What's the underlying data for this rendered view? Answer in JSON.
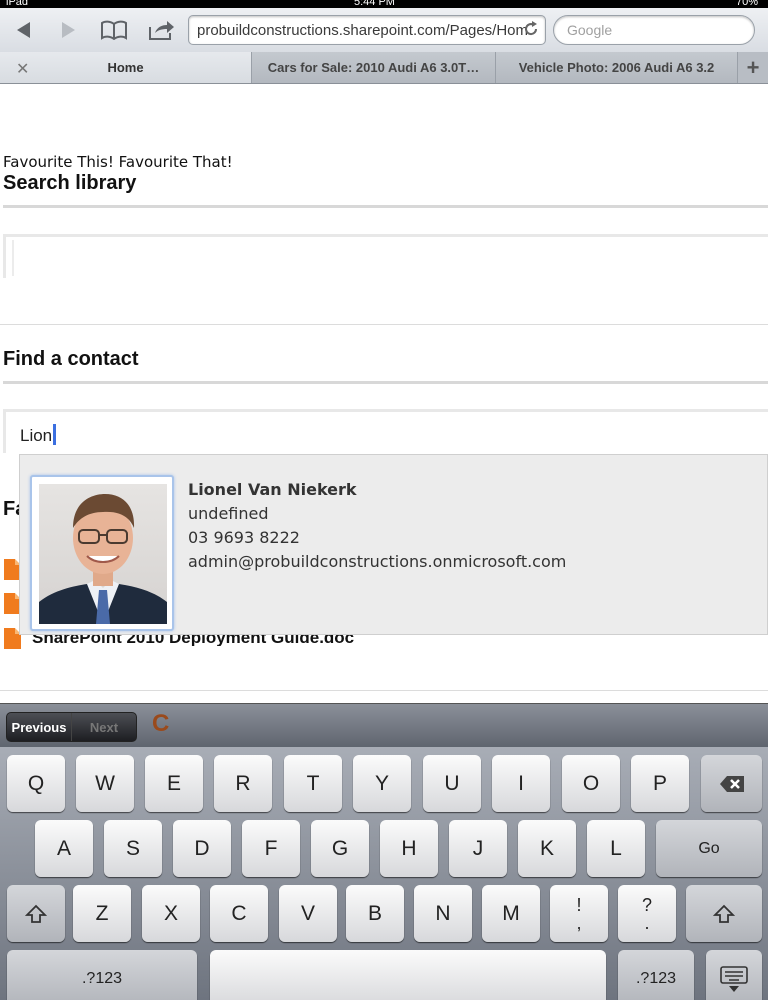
{
  "status": {
    "left": "iPad",
    "time": "5:44 PM",
    "battery": "70%"
  },
  "toolbar": {
    "url": "probuildconstructions.sharepoint.com/Pages/Hom",
    "search_placeholder": "Google"
  },
  "tabs": [
    {
      "label": "Home",
      "active": true
    },
    {
      "label": "Cars for Sale: 2010 Audi A6 3.0T…",
      "active": false
    },
    {
      "label": "Vehicle Photo: 2006 Audi A6 3.2",
      "active": false
    }
  ],
  "page": {
    "fav_line": "Favourite This! Favourite That!",
    "search_heading": "Search library",
    "contact_heading": "Find a contact",
    "contact_value": "Lion",
    "fa_partial": "Fa",
    "doc_link": "SharePoint 2010 Deployment Guide.doc"
  },
  "contact_card": {
    "name": "Lionel Van Niekerk",
    "line1": "undefined",
    "phone": "03 9693 8222",
    "email": "admin@probuildconstructions.onmicrosoft.com"
  },
  "keyboard": {
    "previous": "Previous",
    "next": "Next",
    "behind_text": "C",
    "row1": [
      "Q",
      "W",
      "E",
      "R",
      "T",
      "Y",
      "U",
      "I",
      "O",
      "P"
    ],
    "row2": [
      "A",
      "S",
      "D",
      "F",
      "G",
      "H",
      "J",
      "K",
      "L"
    ],
    "go": "Go",
    "row3": [
      "Z",
      "X",
      "C",
      "V",
      "B",
      "N",
      "M"
    ],
    "punct1_top": "!",
    "punct1_bottom": ",",
    "punct2_top": "?",
    "punct2_bottom": ".",
    "numbers": ".?123"
  },
  "colors": {
    "accent": "#3b6fe0",
    "doc_icon": "#f07b1e"
  }
}
